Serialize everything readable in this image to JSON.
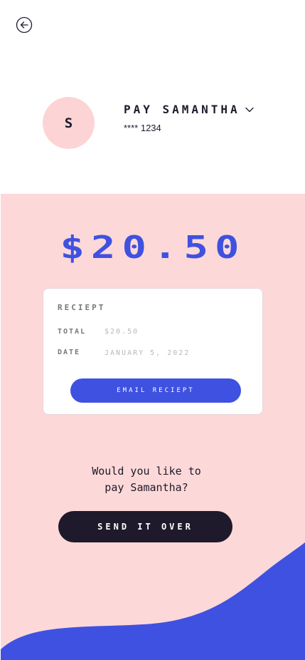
{
  "header": {
    "back_icon": "arrow-left-circle-icon"
  },
  "payee": {
    "initial": "S",
    "title": "PAY SAMANTHA",
    "card_masked": "**** 1234",
    "dropdown_icon": "chevron-down-icon"
  },
  "payment": {
    "amount": "$20.50"
  },
  "receipt": {
    "title": "RECIEPT",
    "total_label": "TOTAL",
    "total_value": "$20.50",
    "date_label": "DATE",
    "date_value": "JANUARY 5, 2022",
    "email_button": "EMAIL RECIEPT"
  },
  "confirm": {
    "prompt_line1": "Would you like to",
    "prompt_line2": "pay Samantha?",
    "send_button": "SEND IT OVER"
  },
  "colors": {
    "accent": "#3f51e0",
    "pink": "#fdd8d9",
    "dark": "#1e1a2b"
  }
}
